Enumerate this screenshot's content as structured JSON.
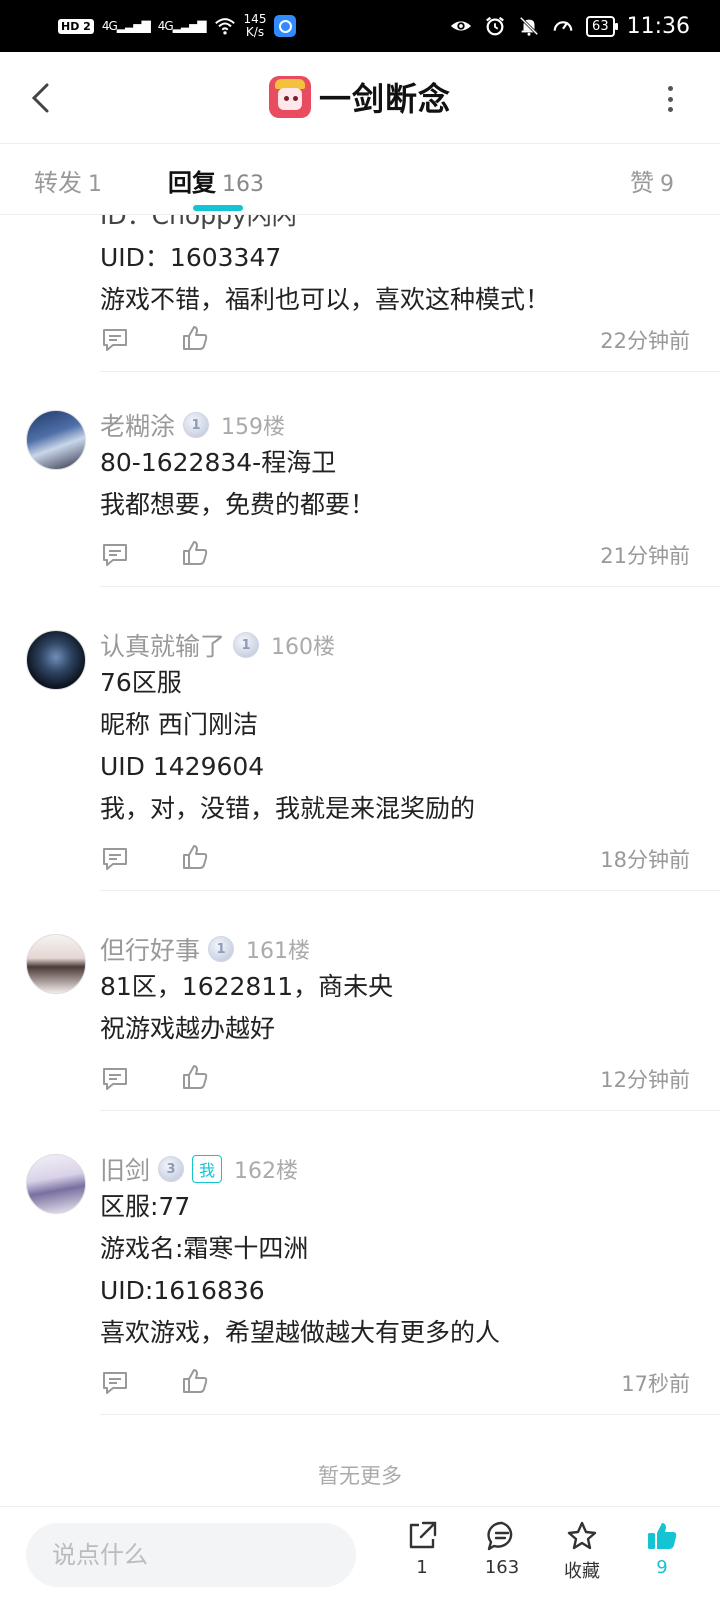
{
  "status_bar": {
    "hd_label": "HD 2",
    "signal1": "4G",
    "signal2": "4G",
    "speed_value": "145",
    "speed_unit": "K/s",
    "battery": "63",
    "time": "11:36"
  },
  "header": {
    "title": "一剑断念"
  },
  "tabs": [
    {
      "label": "转发",
      "count": "1"
    },
    {
      "label": "回复",
      "count": "163"
    },
    {
      "label": "赞",
      "count": "9"
    }
  ],
  "comments": [
    {
      "partial_top": "ID：Choppy闪闪",
      "lines": [
        "UID：1603347",
        "游戏不错，福利也可以，喜欢这种模式！"
      ],
      "time": "22分钟前"
    },
    {
      "user": "老糊涂",
      "level": "1",
      "floor": "159楼",
      "lines": [
        "80-1622834-程海卫",
        "我都想要，免费的都要！"
      ],
      "time": "21分钟前"
    },
    {
      "user": "认真就输了",
      "level": "1",
      "floor": "160楼",
      "lines": [
        "76区服",
        "昵称 西门刚洁",
        "UID 1429604",
        "我，对，没错，我就是来混奖励的"
      ],
      "time": "18分钟前"
    },
    {
      "user": "但行好事",
      "level": "1",
      "floor": "161楼",
      "lines": [
        "81区，1622811，商未央",
        "祝游戏越办越好"
      ],
      "time": "12分钟前"
    },
    {
      "user": "旧剑",
      "level": "3",
      "me_badge": "我",
      "floor": "162楼",
      "lines": [
        "区服:77",
        "游戏名:霜寒十四洲",
        "UID:1616836",
        "喜欢游戏，希望越做越大有更多的人"
      ],
      "time": "17秒前"
    }
  ],
  "no_more": "暂无更多",
  "bottom_bar": {
    "input_placeholder": "说点什么",
    "share_count": "1",
    "comment_count": "163",
    "favorite_label": "收藏",
    "like_count": "9"
  },
  "colors": {
    "accent": "#14c4d2",
    "text_muted": "#999999"
  }
}
